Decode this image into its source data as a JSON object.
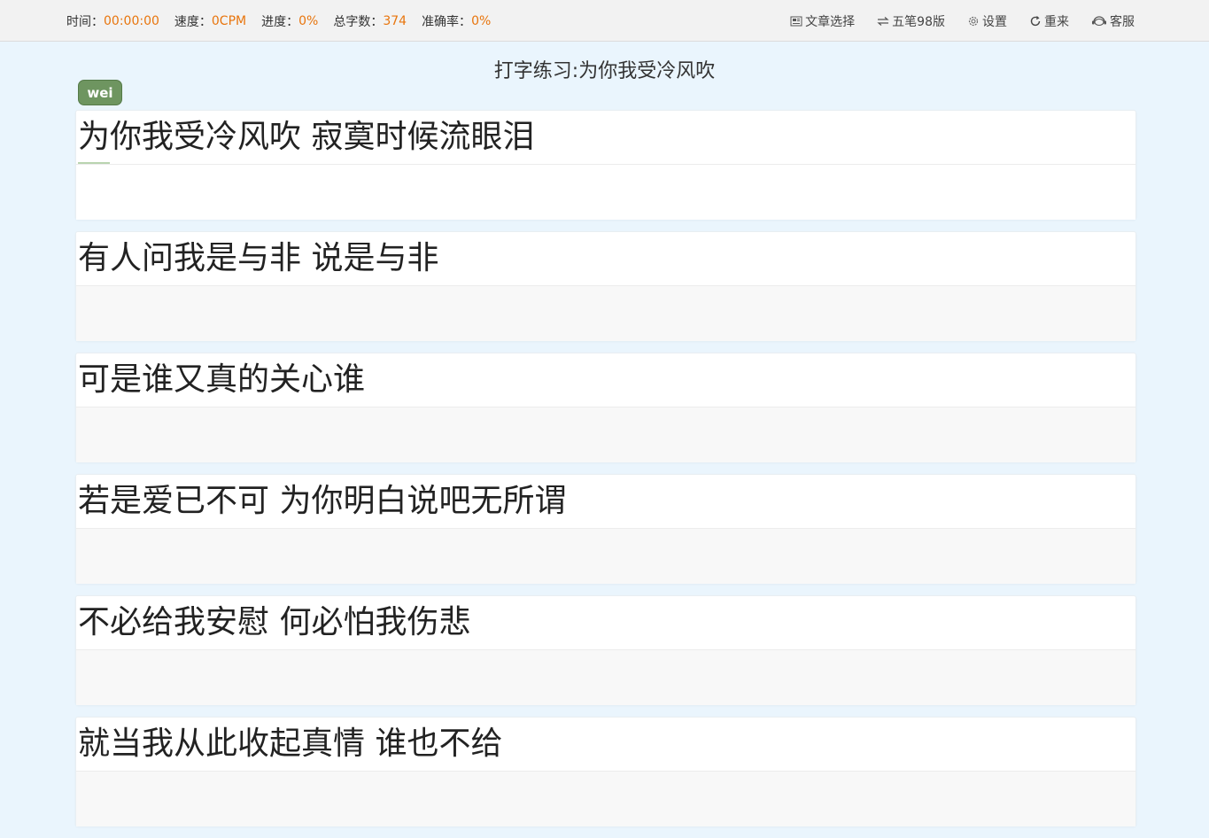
{
  "stats": [
    {
      "label": "时间：",
      "value": "00:00:00"
    },
    {
      "label": "速度：",
      "value": "0CPM"
    },
    {
      "label": "进度：",
      "value": "0%"
    },
    {
      "label": "总字数：",
      "value": "374"
    },
    {
      "label": "准确率：",
      "value": "0%"
    }
  ],
  "actions": {
    "article": "文章选择",
    "mode": "五笔98版",
    "settings": "设置",
    "restart": "重来",
    "service": "客服"
  },
  "title": "打字练习:为你我受冷风吹",
  "user": "wei",
  "lines": [
    "为你我受冷风吹 寂寞时候流眼泪",
    "有人问我是与非 说是与非",
    "可是谁又真的关心谁",
    "若是爱已不可 为你明白说吧无所谓",
    "不必给我安慰 何必怕我伤悲",
    "就当我从此收起真情 谁也不给"
  ],
  "colors": {
    "accent": "#e8750d",
    "badge": "#6e9560",
    "background": "#eaf5fd"
  }
}
